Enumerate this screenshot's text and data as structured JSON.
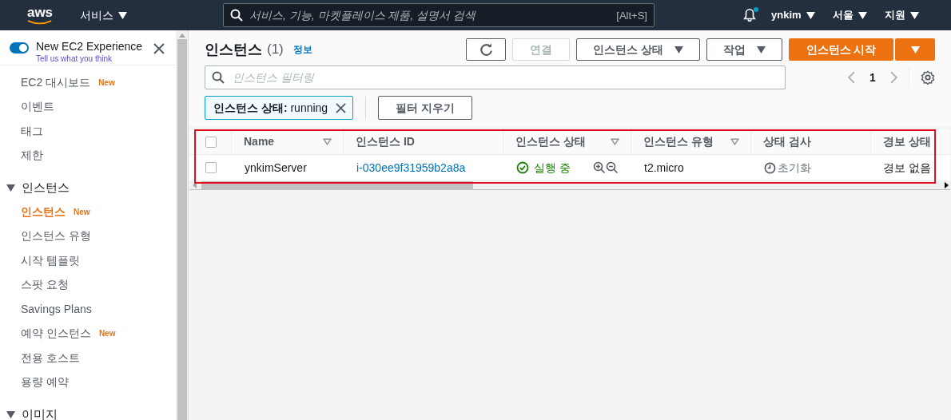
{
  "top_bar": {
    "logo": "aws",
    "services": "서비스",
    "search_placeholder": "서비스, 기능, 마켓플레이스 제품, 설명서 검색",
    "search_shortcut": "[Alt+S]",
    "notification_dot": true,
    "user": "ynkim",
    "region": "서울",
    "support": "지원"
  },
  "sidebar": {
    "toggle": {
      "label": "New EC2 Experience",
      "link": "Tell us what you think",
      "on": true
    },
    "items": [
      {
        "kind": "item",
        "label": "EC2 대시보드",
        "badge": "New",
        "selected": false
      },
      {
        "kind": "item",
        "label": "이벤트",
        "selected": false
      },
      {
        "kind": "item",
        "label": "태그",
        "selected": false
      },
      {
        "kind": "item",
        "label": "제한",
        "selected": false
      },
      {
        "kind": "section",
        "label": "인스턴스",
        "expanded": true,
        "children": [
          {
            "kind": "item",
            "label": "인스턴스",
            "badge": "New",
            "selected": true
          },
          {
            "kind": "item",
            "label": "인스턴스 유형",
            "selected": false
          },
          {
            "kind": "item",
            "label": "시작 템플릿",
            "selected": false
          },
          {
            "kind": "item",
            "label": "스팟 요청",
            "selected": false
          },
          {
            "kind": "item",
            "label": "Savings Plans",
            "selected": false
          },
          {
            "kind": "item",
            "label": "예약 인스턴스",
            "badge": "New",
            "selected": false
          },
          {
            "kind": "item",
            "label": "전용 호스트",
            "selected": false
          },
          {
            "kind": "item",
            "label": "용량 예약",
            "selected": false
          }
        ]
      },
      {
        "kind": "section",
        "label": "이미지",
        "expanded": true
      }
    ]
  },
  "main": {
    "title": "인스턴스",
    "count": "(1)",
    "info": "정보",
    "buttons": [
      {
        "kind": "refresh"
      },
      {
        "kind": "text",
        "label": "연결",
        "disabled": true
      },
      {
        "kind": "dropdown",
        "label": "인스턴스 상태",
        "disabled": false
      },
      {
        "kind": "dropdown",
        "label": "작업",
        "disabled": false
      },
      {
        "kind": "primary",
        "label": "인스턴스 시작"
      }
    ],
    "filter_placeholder": "인스턴스 필터링",
    "page": "1",
    "filter_token": {
      "key": "인스턴스 상태:",
      "value": "running"
    },
    "clear_filters": "필터 지우기",
    "table": {
      "select_all_checked": false,
      "columns": [
        {
          "label": "Name",
          "sortable": true
        },
        {
          "label": "인스턴스 ID",
          "sortable": false
        },
        {
          "label": "인스턴스 상태",
          "sortable": true
        },
        {
          "label": "인스턴스 유형",
          "sortable": true
        },
        {
          "label": "상태 검사",
          "sortable": false
        },
        {
          "label": "경보 상태",
          "sortable": false
        }
      ],
      "rows": [
        {
          "selected": false,
          "name": "ynkimServer",
          "id": "i-030ee9f31959b2a8a",
          "state": "실행 중",
          "type": "t2.micro",
          "check": "초기화",
          "alarm": "경보 없음"
        }
      ]
    },
    "highlight": true
  }
}
